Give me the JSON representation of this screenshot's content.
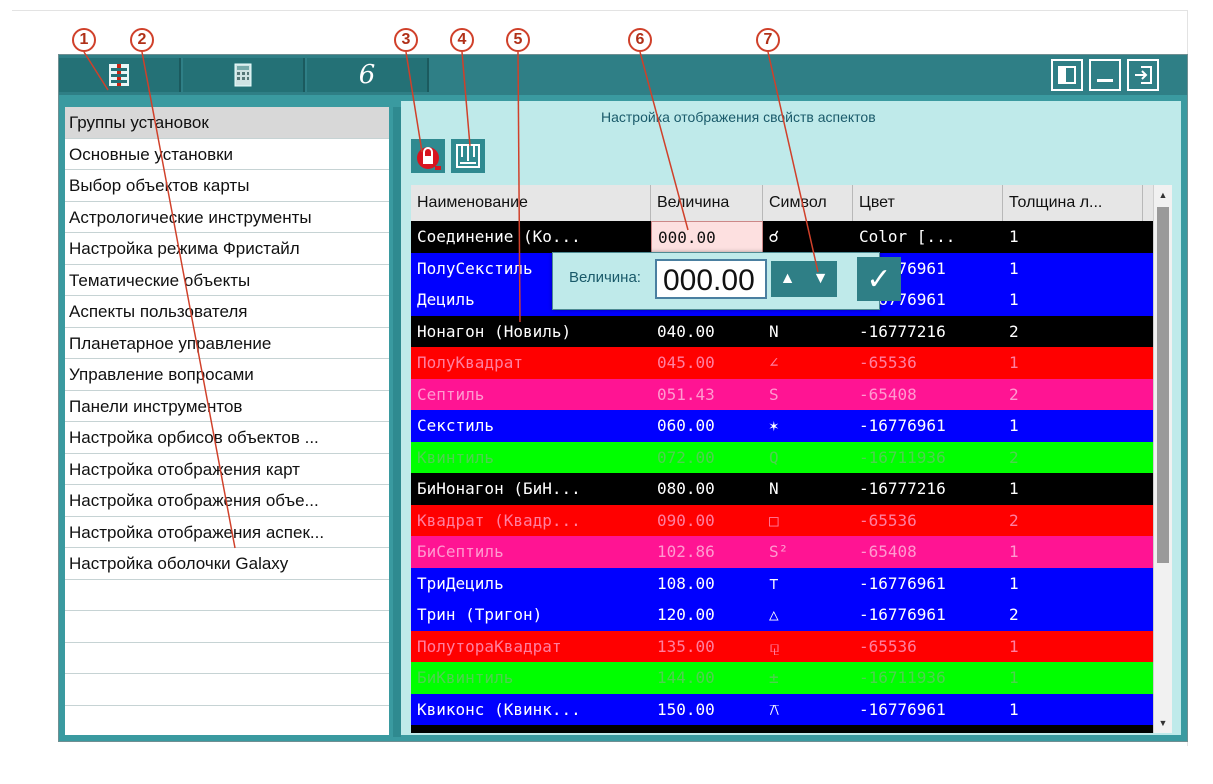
{
  "callouts": [
    "1",
    "2",
    "3",
    "4",
    "5",
    "6",
    "7"
  ],
  "content_title": "Настройка отображения свойств аспектов",
  "sidebar": {
    "items": [
      "Группы установок",
      "Основные установки",
      "Выбор объектов карты",
      "Астрологические инструменты",
      "Настройка режима Фристайл",
      "Тематические объекты",
      "Аспекты пользователя",
      "Планетарное управление",
      "Управление вопросами",
      "Панели инструментов",
      "Настройка орбисов объектов ...",
      "Настройка отображения карт",
      "Настройка отображения объе...",
      "Настройка отображения аспек...",
      "Настройка оболочки Galaxy"
    ]
  },
  "grid": {
    "headers": [
      "Наименование",
      "Величина",
      "Символ",
      "Цвет",
      "Толщина л..."
    ],
    "rows": [
      {
        "name": "Соединение (Ко...",
        "value": "000.00",
        "symbol": "☌",
        "color": "Color [...",
        "width": "1",
        "bg": "#000000",
        "fg": "#ffffff"
      },
      {
        "name": "ПолуСекстиль",
        "value": "",
        "symbol": "",
        "color": "-16776961",
        "width": "1",
        "bg": "#0000ff",
        "fg": "#ffffff"
      },
      {
        "name": "Дециль",
        "value": "",
        "symbol": "",
        "color": "-16776961",
        "width": "1",
        "bg": "#0000ff",
        "fg": "#ffffff"
      },
      {
        "name": "Нонагон (Новиль)",
        "value": "040.00",
        "symbol": "N",
        "color": "-16777216",
        "width": "2",
        "bg": "#000000",
        "fg": "#ffffff"
      },
      {
        "name": "ПолуКвадрат",
        "value": "045.00",
        "symbol": "∠",
        "color": "-65536",
        "width": "1",
        "bg": "#ff0000",
        "fg": "#ff7fa0"
      },
      {
        "name": "Септиль",
        "value": "051.43",
        "symbol": "S",
        "color": "-65408",
        "width": "2",
        "bg": "#ff1493",
        "fg": "#ff9ad0"
      },
      {
        "name": "Секстиль",
        "value": "060.00",
        "symbol": "✶",
        "color": "-16776961",
        "width": "1",
        "bg": "#0000ff",
        "fg": "#ffffff"
      },
      {
        "name": "Квинтиль",
        "value": "072.00",
        "symbol": "Q",
        "color": "-16711936",
        "width": "2",
        "bg": "#00ff00",
        "fg": "#50d050"
      },
      {
        "name": "БиНонагон (БиН...",
        "value": "080.00",
        "symbol": "N",
        "color": "-16777216",
        "width": "1",
        "bg": "#000000",
        "fg": "#ffffff"
      },
      {
        "name": "Квадрат (Квадр...",
        "value": "090.00",
        "symbol": "□",
        "color": "-65536",
        "width": "2",
        "bg": "#ff0000",
        "fg": "#ff7fa0"
      },
      {
        "name": "БиСептиль",
        "value": "102.86",
        "symbol": "S²",
        "color": "-65408",
        "width": "1",
        "bg": "#ff1493",
        "fg": "#ff9ad0"
      },
      {
        "name": "ТриДециль",
        "value": "108.00",
        "symbol": "⊤",
        "color": "-16776961",
        "width": "1",
        "bg": "#0000ff",
        "fg": "#ffffff"
      },
      {
        "name": "Трин (Тригон)",
        "value": "120.00",
        "symbol": "△",
        "color": "-16776961",
        "width": "2",
        "bg": "#0000ff",
        "fg": "#ffffff"
      },
      {
        "name": "ПолутораКвадрат",
        "value": "135.00",
        "symbol": "⚼",
        "color": "-65536",
        "width": "1",
        "bg": "#ff0000",
        "fg": "#ff7fa0"
      },
      {
        "name": "БиКвинтиль",
        "value": "144.00",
        "symbol": "±",
        "color": "-16711936",
        "width": "1",
        "bg": "#00ff00",
        "fg": "#50d050"
      },
      {
        "name": "Квиконс (Квинк...",
        "value": "150.00",
        "symbol": "⚻",
        "color": "-16776961",
        "width": "1",
        "bg": "#0000ff",
        "fg": "#ffffff"
      }
    ]
  },
  "editor": {
    "label": "Величина:",
    "value": "000.00",
    "up": "▲",
    "down": "▼",
    "ok": "✓"
  },
  "colors": {
    "teal": "#2f7f86",
    "panel": "#bfeaea"
  }
}
